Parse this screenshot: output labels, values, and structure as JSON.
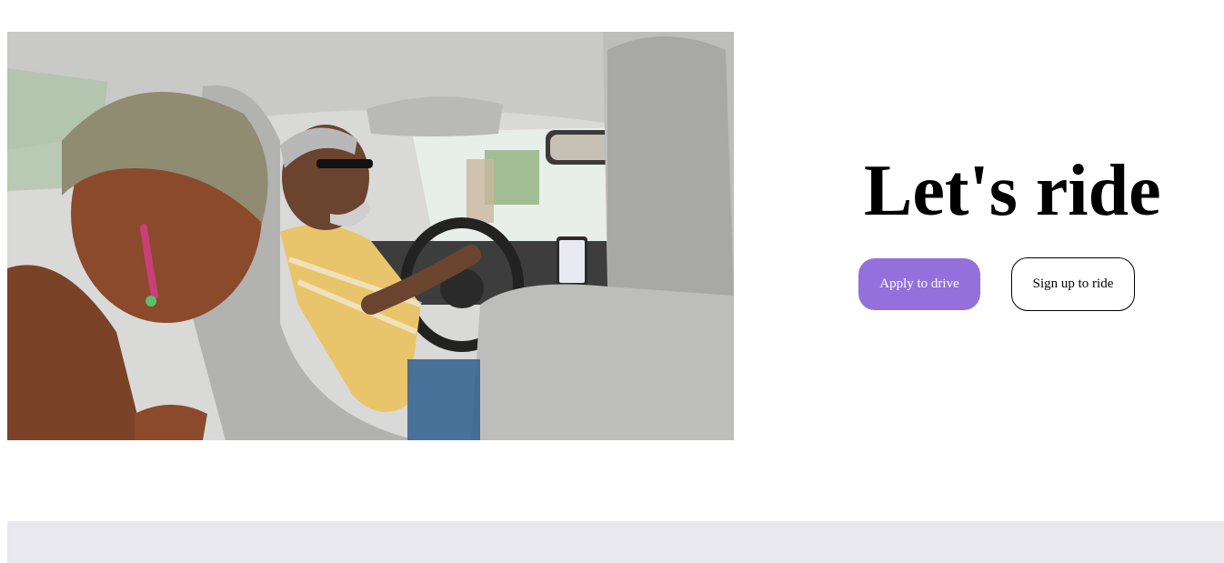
{
  "hero": {
    "headline": "Let's ride",
    "apply_button_label": "Apply to drive",
    "signup_button_label": "Sign up to ride",
    "photo_alt": "Passenger and driver laughing inside a car"
  },
  "colors": {
    "accent": "#9370db",
    "footer_band": "#e9e8ef"
  }
}
